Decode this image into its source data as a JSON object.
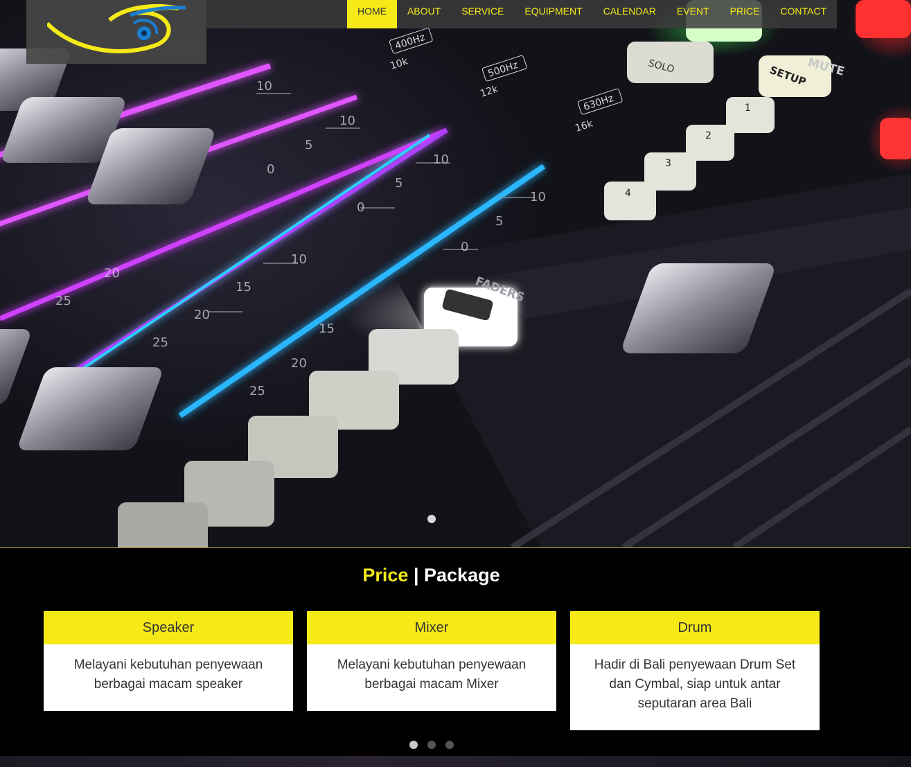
{
  "nav": {
    "items": [
      "HOME",
      "ABOUT",
      "SERVICE",
      "EQUIPMENT",
      "CALENDAR",
      "EVENT",
      "PRICE",
      "CONTACT"
    ],
    "active": "HOME"
  },
  "section": {
    "title_accent": "Price",
    "title_sep": " | ",
    "title_rest": "Package"
  },
  "cards": [
    {
      "title": "Speaker",
      "text": "Melayani kebutuhan penyewaan berbagai macam speaker"
    },
    {
      "title": "Mixer",
      "text": "Melayani kebutuhan penyewaan berbagai macam Mixer"
    },
    {
      "title": "Drum",
      "text": "Hadir di Bali penyewaan Drum Set dan Cymbal, siap untuk antar seputaran area Bali"
    }
  ],
  "hero_labels": [
    "400Hz",
    "500Hz",
    "630Hz",
    "10k",
    "12k",
    "16k",
    "SOLO",
    "SETUP",
    "MUTE",
    "FADERS",
    "1",
    "2",
    "3",
    "4"
  ],
  "colors": {
    "accent": "#f5ea18",
    "nav_bg": "#3c3c3c",
    "card_text": "#333333"
  }
}
